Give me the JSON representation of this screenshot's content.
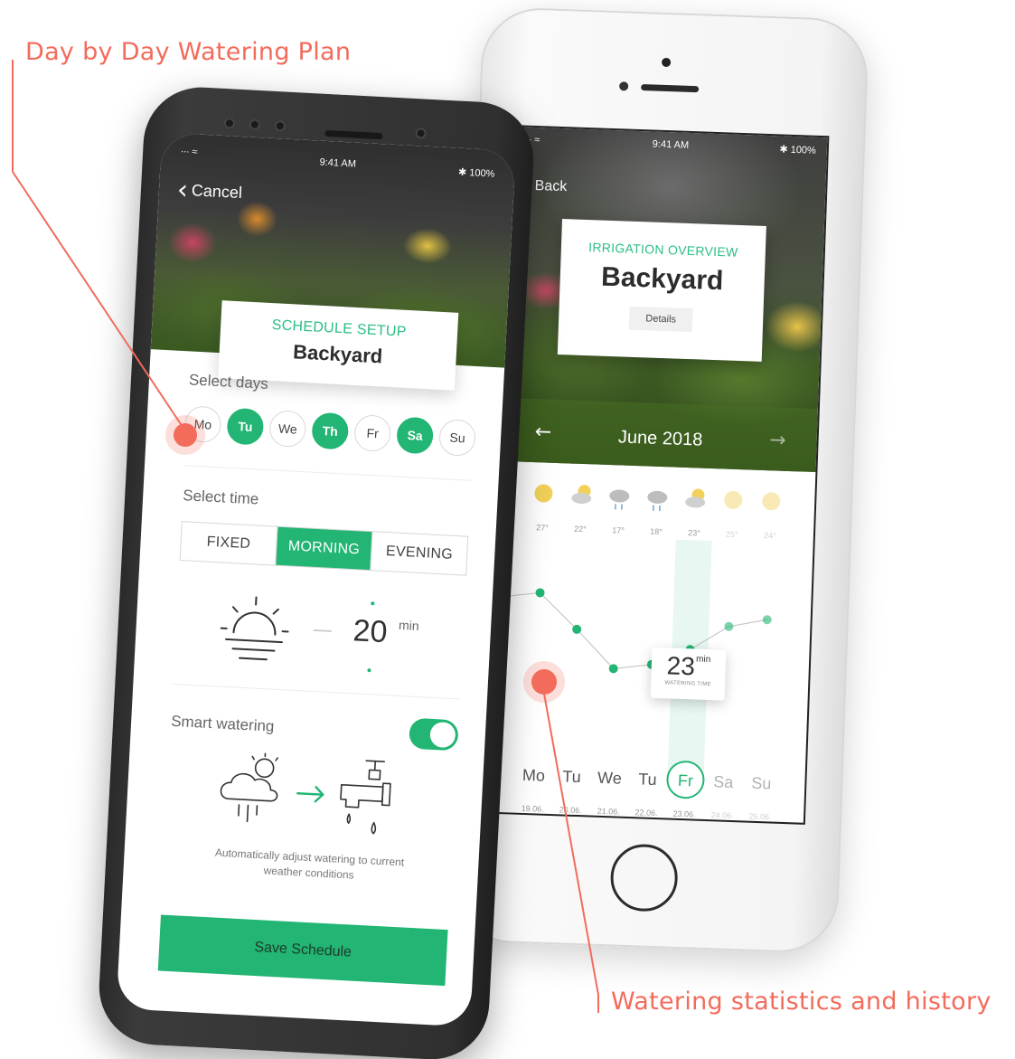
{
  "callouts": {
    "left": "Day by Day Watering Plan",
    "right": "Watering statistics and history"
  },
  "colors": {
    "accent": "#22b573",
    "callout": "#f26b5b"
  },
  "right_phone": {
    "status": {
      "signal": "∙∙∙ ≈",
      "time": "9:41 AM",
      "battery": "✱ 100%"
    },
    "back_label": "Back",
    "card": {
      "kicker": "IRRIGATION OVERVIEW",
      "title": "Backyard",
      "details_label": "Details"
    },
    "month": {
      "label": "June 2018",
      "prev_icon": "arrow-left-icon",
      "next_icon": "arrow-right-icon"
    },
    "tooltip": {
      "value": "23",
      "unit": "min",
      "caption": "WATERING TIME"
    }
  },
  "left_phone": {
    "status": {
      "signal": "∙∙∙ ≈",
      "time": "9:41 AM",
      "battery": "✱ 100%"
    },
    "cancel_label": "Cancel",
    "card": {
      "kicker": "SCHEDULE SETUP",
      "title": "Backyard"
    },
    "select_days_label": "Select days",
    "days": [
      {
        "label": "Mo",
        "selected": false
      },
      {
        "label": "Tu",
        "selected": true
      },
      {
        "label": "We",
        "selected": false
      },
      {
        "label": "Th",
        "selected": true
      },
      {
        "label": "Fr",
        "selected": false
      },
      {
        "label": "Sa",
        "selected": true
      },
      {
        "label": "Su",
        "selected": false
      }
    ],
    "select_time_label": "Select time",
    "time_options": [
      {
        "label": "FIXED",
        "selected": false
      },
      {
        "label": "MORNING",
        "selected": true
      },
      {
        "label": "EVENING",
        "selected": false
      }
    ],
    "duration": {
      "value": "20",
      "unit": "min"
    },
    "smart_watering_label": "Smart watering",
    "smart_watering_on": true,
    "smart_watering_desc": "Automatically adjust watering to current weather conditions",
    "save_label": "Save Schedule"
  },
  "chart_data": {
    "type": "line",
    "title": "",
    "xlabel": "",
    "ylabel": "",
    "categories": [
      "Mo",
      "Tu",
      "We",
      "Tu",
      "Fr",
      "Sa",
      "Su"
    ],
    "dates": [
      "19.06.",
      "20.06.",
      "21.06.",
      "22.06.",
      "23.06.",
      "24.06.",
      "25.06."
    ],
    "temperatures": [
      "27°",
      "22°",
      "17°",
      "18°",
      "23°",
      "25°",
      "24°"
    ],
    "weather_icons": [
      "sun-icon",
      "partly-cloudy-icon",
      "rain-cloud-icon",
      "rain-cloud-icon",
      "partly-cloudy-icon",
      "sun-icon",
      "sun-icon"
    ],
    "series": [
      {
        "values": [
          42,
          29,
          15,
          17,
          23,
          32,
          35
        ]
      }
    ],
    "ylim": [
      0,
      50
    ],
    "highlight_index": 4,
    "grid": false
  }
}
